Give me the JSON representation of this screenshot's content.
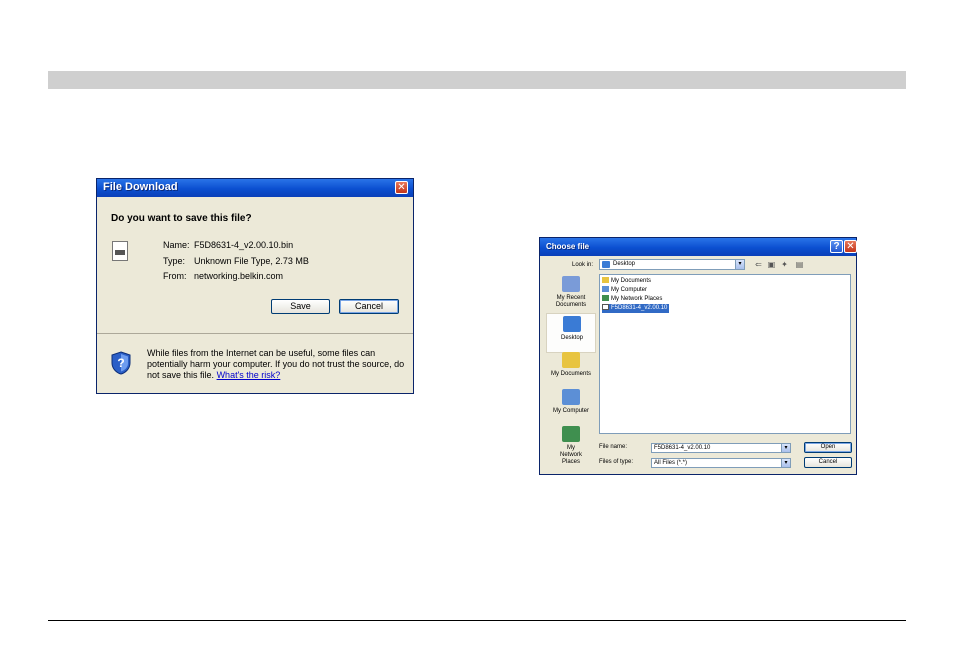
{
  "file_download": {
    "title": "File Download",
    "close_glyph": "✕",
    "question": "Do you want to save this file?",
    "name_label": "Name:",
    "name_value": "F5D8631-4_v2.00.10.bin",
    "type_label": "Type:",
    "type_value": "Unknown File Type, 2.73 MB",
    "from_label": "From:",
    "from_value": "networking.belkin.com",
    "save_button": "Save",
    "cancel_button": "Cancel",
    "warning_text": "While files from the Internet can be useful, some files can potentially harm your computer. If you do not trust the source, do not save this file.",
    "risk_link": "What's the risk?",
    "icons": {
      "file": "file-icon",
      "shield": "shield-question-icon"
    }
  },
  "choose_file": {
    "title": "Choose file",
    "help_glyph": "?",
    "close_glyph": "✕",
    "look_in_label": "Look in:",
    "look_in_value": "Desktop",
    "toolbar_icons": [
      "back-icon",
      "up-folder-icon",
      "new-folder-icon",
      "view-menu-icon"
    ],
    "toolbar_glyphs": [
      "⇐",
      "▣",
      "✦",
      "▤"
    ],
    "places": [
      {
        "label": "My Recent Documents",
        "icon": "recent-documents-icon",
        "color": "#7a9bd8"
      },
      {
        "label": "Desktop",
        "icon": "desktop-icon",
        "color": "#3a7bd5",
        "selected": true
      },
      {
        "label": "My Documents",
        "icon": "my-documents-icon",
        "color": "#e8c440"
      },
      {
        "label": "My Computer",
        "icon": "my-computer-icon",
        "color": "#5c8fd6"
      },
      {
        "label": "My Network Places",
        "icon": "network-places-icon",
        "color": "#3f8f4f"
      }
    ],
    "files": [
      {
        "name": "My Documents",
        "icon": "folder-icon"
      },
      {
        "name": "My Computer",
        "icon": "computer-icon"
      },
      {
        "name": "My Network Places",
        "icon": "network-icon"
      },
      {
        "name": "F5D8631-4_v2.00.10",
        "icon": "file-icon",
        "selected": true
      }
    ],
    "file_name_label": "File name:",
    "file_name_value": "F5D8631-4_v2.00.10",
    "file_type_label": "Files of type:",
    "file_type_value": "All Files (*.*)",
    "open_button": "Open",
    "cancel_button": "Cancel"
  },
  "colors": {
    "title_blue": "#0b4fd0",
    "selection": "#316ac5",
    "dialog_bg": "#ece9d8",
    "header_bar": "#cfcfcf"
  }
}
